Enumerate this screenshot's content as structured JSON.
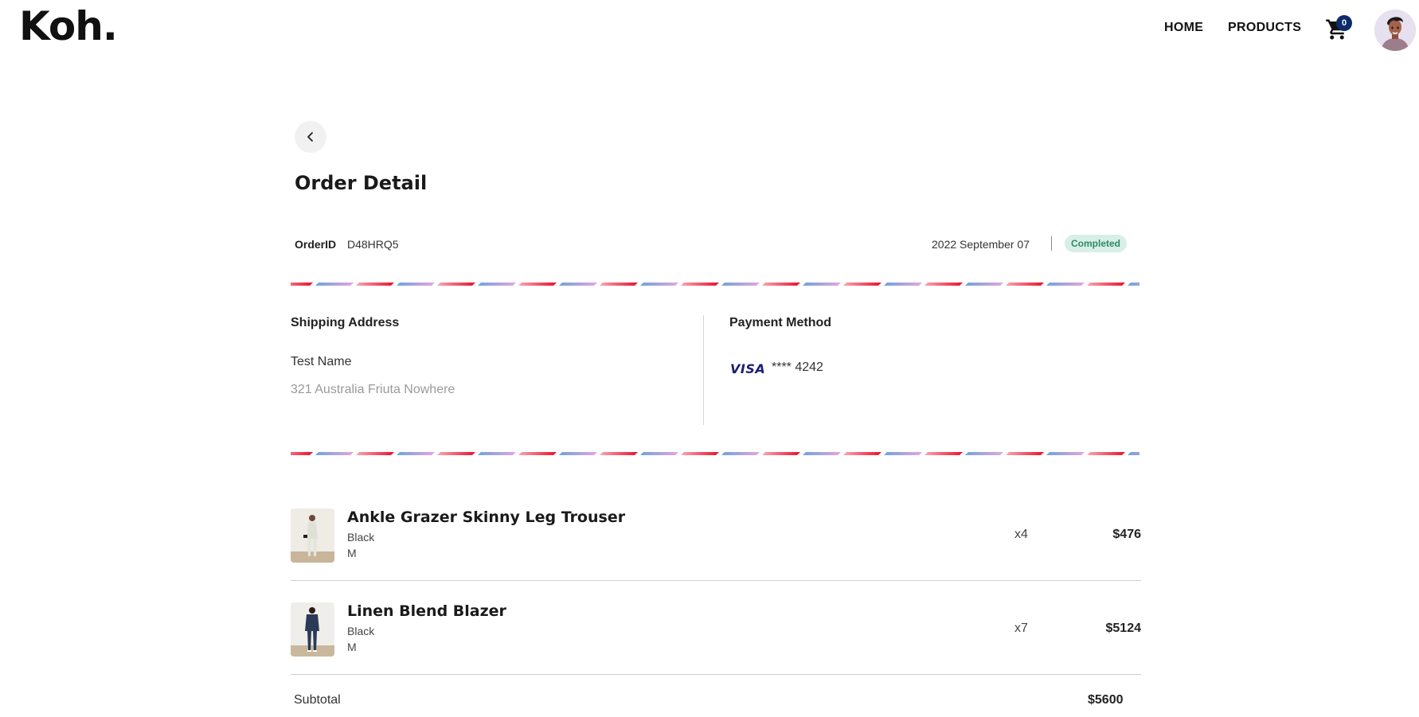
{
  "header": {
    "logo": "Koh.",
    "nav": {
      "home": "HOME",
      "products": "PRODUCTS"
    },
    "cart_count": "0"
  },
  "page": {
    "title": "Order Detail"
  },
  "order": {
    "id_label": "OrderID",
    "id_value": "D48HRQ5",
    "date": "2022 September 07",
    "status": "Completed"
  },
  "shipping": {
    "heading": "Shipping Address",
    "name": "Test  Name",
    "address": "321 Australia Friuta Nowhere"
  },
  "payment": {
    "heading": "Payment Method",
    "brand": "VISA",
    "card_number": "**** 4242"
  },
  "items": [
    {
      "name": "Ankle Grazer Skinny Leg Trouser",
      "color": "Black",
      "size": "M",
      "qty": "x4",
      "price": "$476"
    },
    {
      "name": "Linen Blend Blazer",
      "color": "Black",
      "size": "M",
      "qty": "x7",
      "price": "$5124"
    }
  ],
  "summary": {
    "subtotal_label": "Subtotal",
    "subtotal_value": "$5600"
  },
  "colors": {
    "status_bg": "#d8efe6",
    "status_text": "#2f8a67",
    "cart_badge": "#0d2a6b",
    "stripe_red": "#e8112d",
    "stripe_blue": "#6fa3dc",
    "stripe_pink": "#e5a6dd"
  }
}
